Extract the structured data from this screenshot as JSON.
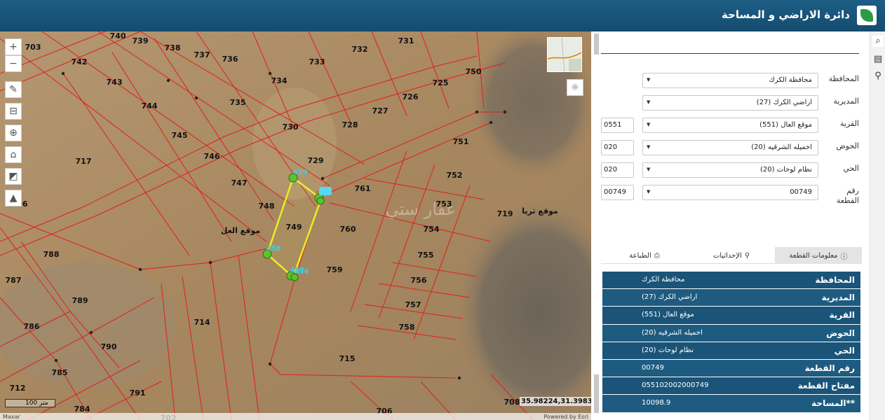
{
  "header": {
    "title": "دائرة الاراضي و المساحة"
  },
  "map": {
    "parcel_labels": [
      "740",
      "739",
      "738",
      "737",
      "736",
      "733",
      "732",
      "731",
      "703",
      "742",
      "743",
      "734",
      "726",
      "725",
      "750",
      "744",
      "735",
      "727",
      "745",
      "730",
      "728",
      "751",
      "746",
      "729",
      "717",
      "747",
      "759",
      "761",
      "752",
      "748",
      "753",
      "719",
      "749",
      "760",
      "754",
      "706",
      "788",
      "755",
      "787",
      "756",
      "789",
      "757",
      "714",
      "786",
      "758",
      "790",
      "715",
      "712",
      "785",
      "791",
      "784",
      "708",
      "706",
      "702"
    ],
    "vertex_labels": [
      "459",
      "458",
      "457",
      "456"
    ],
    "place_labels": [
      "موقع العل",
      "موقع ثريا"
    ],
    "watermark": "عقار ستي",
    "tools": [
      "zoom-in-icon",
      "zoom-out-icon",
      "draw-icon",
      "measure-icon",
      "locate-icon",
      "home-icon",
      "chart-icon",
      "compass-icon"
    ],
    "scalebar_label": "100 متر",
    "coordinates": "35.98224,31.39837",
    "attribution_left": "Maxar",
    "attribution_right": "Powered by Esri"
  },
  "form": {
    "fields": [
      {
        "label": "المحافظة",
        "value": "محافظة الكرك",
        "code": ""
      },
      {
        "label": "المديرية",
        "value": "اراضي الكرك (27)",
        "code": ""
      },
      {
        "label": "القرية",
        "value": "موقع العال (551)",
        "code": "0551"
      },
      {
        "label": "الحوض",
        "value": "اخميله الشرقيه (20)",
        "code": "020"
      },
      {
        "label": "الحي",
        "value": "نظام لوحات (20)",
        "code": "020"
      },
      {
        "label": "رقم القطعة",
        "value": "00749",
        "code": "00749"
      }
    ]
  },
  "tabs": [
    {
      "label": "معلومات القطعة",
      "icon": "info-icon"
    },
    {
      "label": "الإحداثيات",
      "icon": "pin-icon"
    },
    {
      "label": "الطباعة",
      "icon": "print-icon"
    }
  ],
  "info": {
    "rows": [
      {
        "key": "المحافظة",
        "value": "محافظة الكرك"
      },
      {
        "key": "المديرية",
        "value": "اراضي الكرك (27)"
      },
      {
        "key": "القرية",
        "value": "موقع العال (551)"
      },
      {
        "key": "الحوض",
        "value": "اخميله الشرقيه (20)"
      },
      {
        "key": "الحي",
        "value": "نظام لوحات (20)"
      },
      {
        "key": "رقم القطعة",
        "value": "00749"
      },
      {
        "key": "مفتاح القطعة",
        "value": "055102002000749"
      },
      {
        "key": "**المساحة",
        "value": "10098.9"
      }
    ]
  },
  "colors": {
    "header": "#1d5d85",
    "panel_row": "#1e5b80",
    "parcel_line": "#e0201a",
    "selected_parcel": "#e8f020"
  }
}
